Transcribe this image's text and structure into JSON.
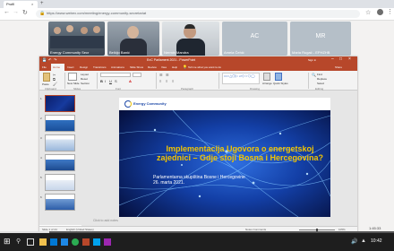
{
  "browser": {
    "tab_title": "Profil",
    "url": "https://www.webex.com/meeting/energy-community-secretariat",
    "accent": "#5b5b5b"
  },
  "participants": [
    {
      "name": "Energy Community Secr",
      "initials": ""
    },
    {
      "name": "Belkijo Banić",
      "initials": ""
    },
    {
      "name": "Nermin Mandra",
      "initials": ""
    },
    {
      "name": "Amela Čehić",
      "initials": "AC"
    },
    {
      "name": "Maria Rugač - EPHZHB",
      "initials": "MR"
    }
  ],
  "ppt": {
    "window_title": "EnC Parliament 2021 - PowerPoint",
    "user": "Sign in",
    "share": "Share",
    "tabs": [
      "File",
      "Home",
      "Insert",
      "Design",
      "Transitions",
      "Animations",
      "Slide Show",
      "Review",
      "View",
      "Help"
    ],
    "tell_me": "Tell me what you want to do",
    "ribbon_groups": [
      "Clipboard",
      "Slides",
      "Font",
      "Paragraph",
      "Drawing",
      "Editing"
    ],
    "ribbon_buttons": [
      "Paste",
      "New Slide",
      "Layout",
      "Reset",
      "Section",
      "Arrange",
      "Quick Styles",
      "Find",
      "Replace",
      "Select"
    ],
    "thumb_numbers": [
      "1",
      "2",
      "3",
      "4",
      "5",
      "6"
    ],
    "notes_placeholder": "Click to add notes",
    "status_left": "Slide 1 of 24",
    "status_lang": "English (United States)",
    "status_right": "Notes  Comments",
    "zoom": "105%"
  },
  "slide": {
    "logo_text": "Energy Community",
    "title": "Implementacija Ugovora o energetskoj zajednici – Gdje stoji Bosna i Hercegovina?",
    "subtitle_line1": "Parlamentarna skupština Bosne i Hercegovine",
    "subtitle_line2": "26. marta 2021."
  },
  "meeting": {
    "time_display": "1:45:33"
  },
  "taskbar": {
    "clock": "10:42"
  },
  "colors": {
    "ppt_accent": "#b7472a",
    "slide_bg": "#0a1a5a",
    "slide_title": "#f2c400",
    "tile_dark": "#3a4a5a",
    "tile_gray": "#b5bfc8"
  }
}
